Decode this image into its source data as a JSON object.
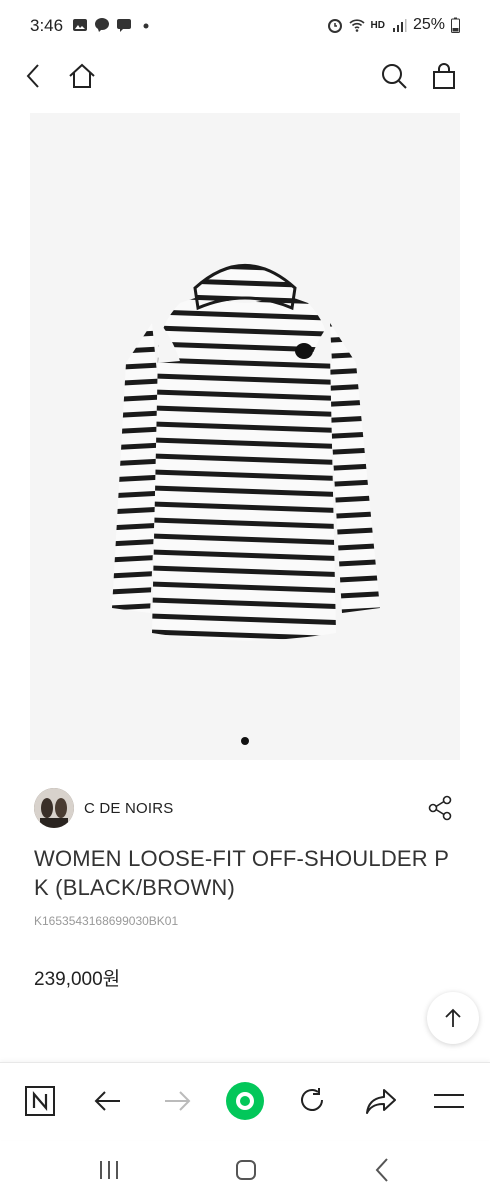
{
  "status_bar": {
    "time": "3:46",
    "battery": "25%",
    "network": "HD"
  },
  "header": {
    "back_icon": "chevron-left-icon",
    "home_icon": "home-icon",
    "search_icon": "search-icon",
    "cart_icon": "shopping-bag-icon"
  },
  "carousel": {
    "total": 1,
    "active": 1
  },
  "product": {
    "brand": "C DE NOIRS",
    "title": "WOMEN LOOSE-FIT OFF-SHOULDER PK (BLACK/BROWN)",
    "code": "K1653543168699030BK01",
    "price": "239,000원"
  },
  "browser_bar": {
    "items": [
      "naver-icon",
      "back-arrow-icon",
      "forward-arrow-icon",
      "green-dot-icon",
      "refresh-icon",
      "share-arrow-icon",
      "menu-icon"
    ],
    "accent": "#03c75a"
  },
  "nav_bar": {
    "items": [
      "recent-apps-icon",
      "home-icon",
      "back-icon"
    ]
  }
}
